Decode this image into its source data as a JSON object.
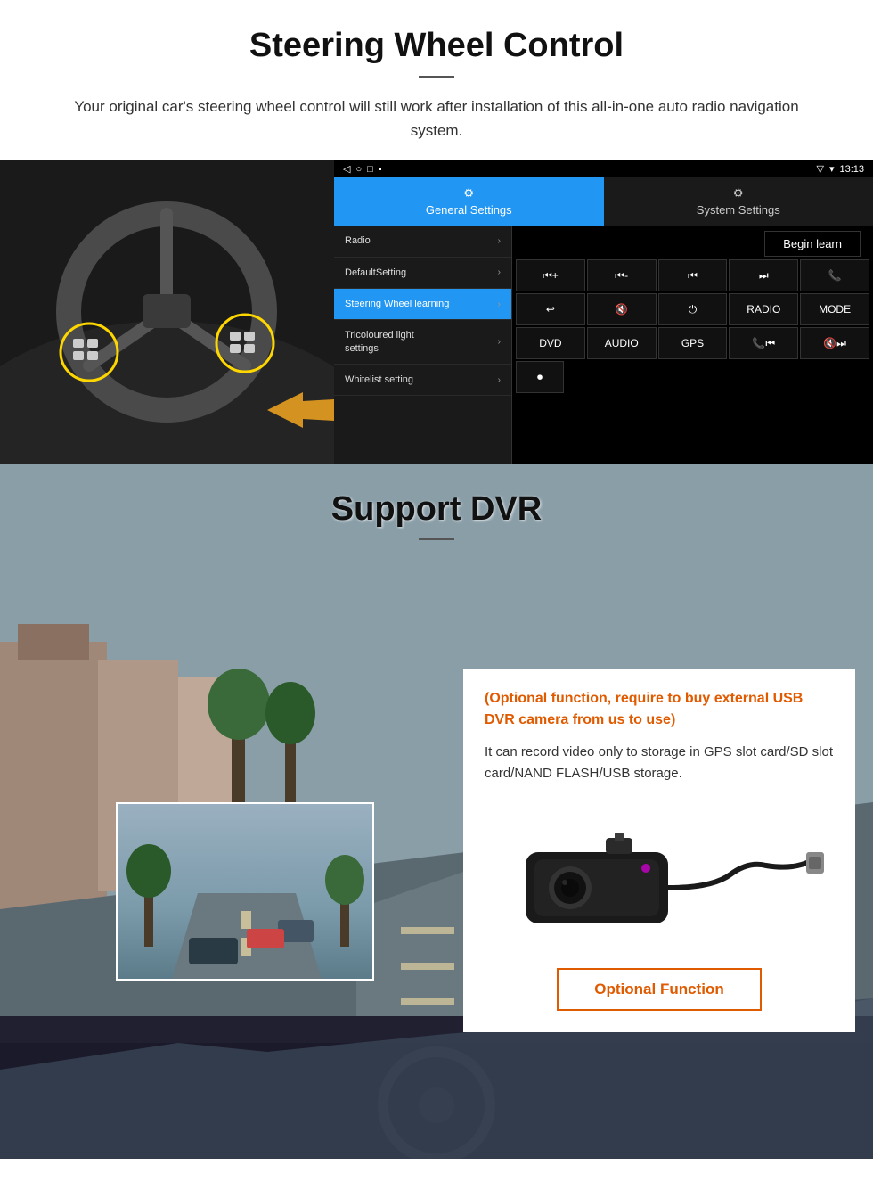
{
  "header": {
    "title": "Steering Wheel Control",
    "divider": true,
    "subtitle": "Your original car's steering wheel control will still work after installation of this all-in-one auto radio navigation system."
  },
  "android_ui": {
    "statusbar": {
      "signal": "▼",
      "wifi": "▾",
      "time": "13:13"
    },
    "navbar": {
      "back": "◁",
      "home": "○",
      "recents": "□",
      "menu": "▪"
    },
    "tabs": [
      {
        "icon": "⚙",
        "label": "General Settings",
        "active": true
      },
      {
        "icon": "⚙",
        "label": "System Settings",
        "active": false
      }
    ],
    "menu_items": [
      {
        "label": "Radio",
        "active": false
      },
      {
        "label": "DefaultSetting",
        "active": false
      },
      {
        "label": "Steering Wheel learning",
        "active": true
      },
      {
        "label": "Tricoloured light settings",
        "active": false
      },
      {
        "label": "Whitelist setting",
        "active": false
      }
    ],
    "begin_learn_btn": "Begin learn",
    "control_buttons_row1": [
      "⏮+",
      "⏮-",
      "⏮",
      "⏭",
      "📞"
    ],
    "control_buttons_row2": [
      "↩",
      "🔇",
      "⏻",
      "RADIO",
      "MODE"
    ],
    "control_buttons_row3": [
      "DVD",
      "AUDIO",
      "GPS",
      "📞⏮",
      "🔇⏭"
    ],
    "control_buttons_row4": [
      "⏺"
    ]
  },
  "dvr_section": {
    "title": "Support DVR",
    "optional_text": "(Optional function, require to buy external USB DVR camera from us to use)",
    "description": "It can record video only to storage in GPS slot card/SD slot card/NAND FLASH/USB storage.",
    "optional_function_btn": "Optional Function"
  }
}
